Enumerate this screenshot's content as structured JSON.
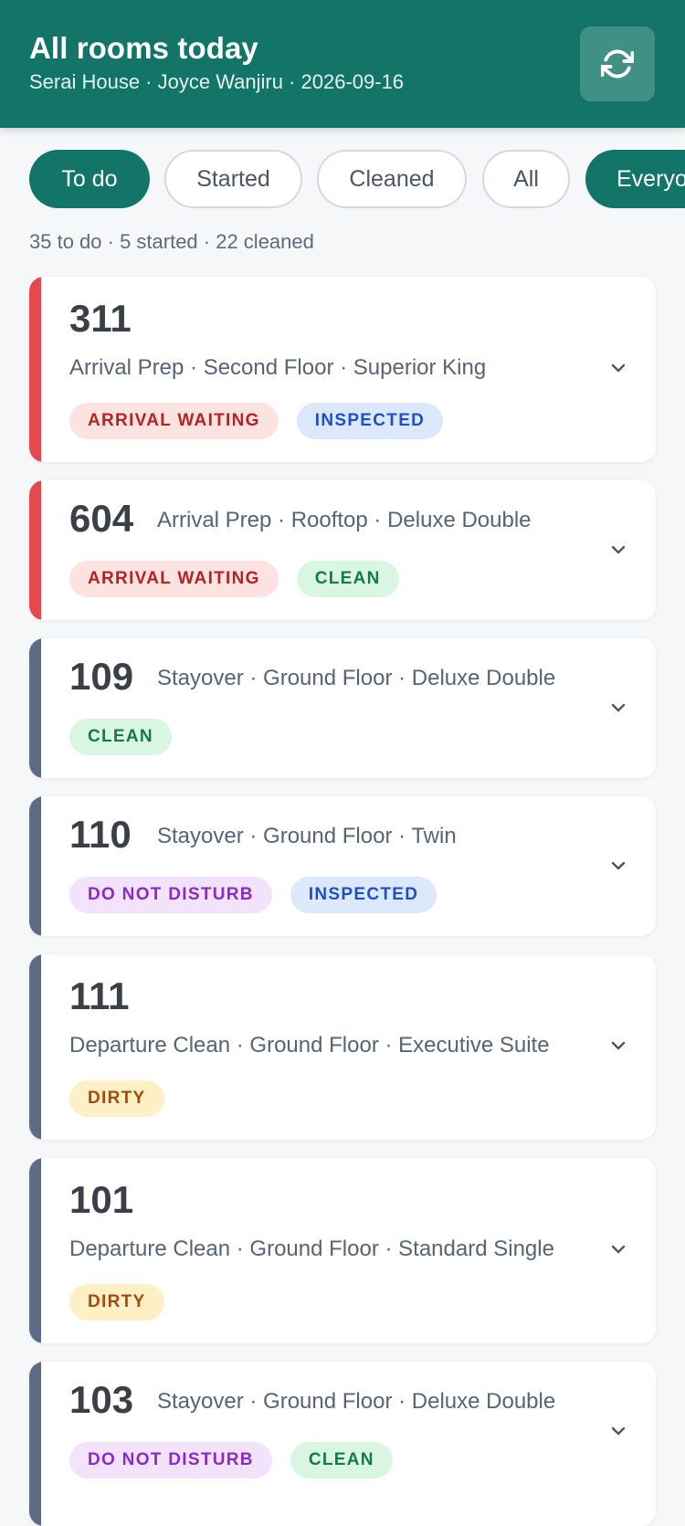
{
  "header": {
    "title": "All rooms today",
    "subtitle": "Serai House · Joyce Wanjiru · 2026-09-16",
    "refresh_icon": "refresh-icon"
  },
  "filters": [
    {
      "label": "To do",
      "active": true
    },
    {
      "label": "Started",
      "active": false
    },
    {
      "label": "Cleaned",
      "active": false
    },
    {
      "label": "All",
      "active": false
    },
    {
      "label": "Everyone",
      "active": true
    }
  ],
  "summary": "35 to do · 5 started · 22 cleaned",
  "colors": {
    "brand": "#127568",
    "stripe_arrival": "#e5484d",
    "stripe_default": "#5d6b85"
  },
  "badge_styles": {
    "ARRIVAL WAITING": {
      "bg": "#fde2e2",
      "fg": "#b42323"
    },
    "INSPECTED": {
      "bg": "#dce9fd",
      "fg": "#1f4fc4"
    },
    "CLEAN": {
      "bg": "#d8f6e2",
      "fg": "#16794a"
    },
    "DO NOT DISTURB": {
      "bg": "#f2e2fc",
      "fg": "#8a2bc4"
    },
    "DIRTY": {
      "bg": "#fdf0c4",
      "fg": "#a8480f"
    }
  },
  "rooms": [
    {
      "number": "311",
      "info": "Arrival Prep · Second Floor · Superior King",
      "stripe": "arrival",
      "badges": [
        "ARRIVAL WAITING",
        "INSPECTED"
      ]
    },
    {
      "number": "604",
      "info": "Arrival Prep · Rooftop · Deluxe Double",
      "stripe": "arrival",
      "badges": [
        "ARRIVAL WAITING",
        "CLEAN"
      ]
    },
    {
      "number": "109",
      "info": "Stayover · Ground Floor · Deluxe Double",
      "stripe": "default",
      "badges": [
        "CLEAN"
      ]
    },
    {
      "number": "110",
      "info": "Stayover · Ground Floor · Twin",
      "stripe": "default",
      "badges": [
        "DO NOT DISTURB",
        "INSPECTED"
      ]
    },
    {
      "number": "111",
      "info": "Departure Clean · Ground Floor · Executive Suite",
      "stripe": "default",
      "badges": [
        "DIRTY"
      ]
    },
    {
      "number": "101",
      "info": "Departure Clean · Ground Floor · Standard Single",
      "stripe": "default",
      "badges": [
        "DIRTY"
      ]
    },
    {
      "number": "103",
      "info": "Stayover · Ground Floor · Deluxe Double",
      "stripe": "default",
      "badges": [
        "DO NOT DISTURB",
        "CLEAN"
      ]
    }
  ]
}
